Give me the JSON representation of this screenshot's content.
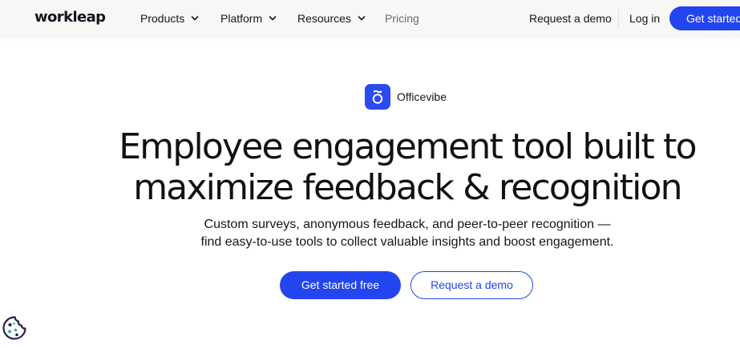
{
  "header": {
    "logo": "workleap",
    "nav": [
      {
        "label": "Products",
        "has_dropdown": true
      },
      {
        "label": "Platform",
        "has_dropdown": true
      },
      {
        "label": "Resources",
        "has_dropdown": true
      },
      {
        "label": "Pricing",
        "has_dropdown": false
      }
    ],
    "request_demo": "Request a demo",
    "login": "Log in",
    "get_started": "Get started"
  },
  "product": {
    "icon": "officevibe-icon",
    "name": "Officevibe"
  },
  "hero": {
    "headline_line1": "Employee engagement tool built to",
    "headline_line2": "maximize feedback & recognition",
    "sub_line1": "Custom surveys, anonymous feedback, and peer-to-peer recognition —",
    "sub_line2": "find easy-to-use tools to collect valuable insights and boost engagement.",
    "primary_cta": "Get started free",
    "secondary_cta": "Request a demo"
  },
  "cookie": {
    "icon": "cookie-icon"
  },
  "colors": {
    "brand_blue": "#2345f0",
    "header_bg": "#f7f7f6",
    "text": "#16151d",
    "muted": "#6b6a70"
  }
}
